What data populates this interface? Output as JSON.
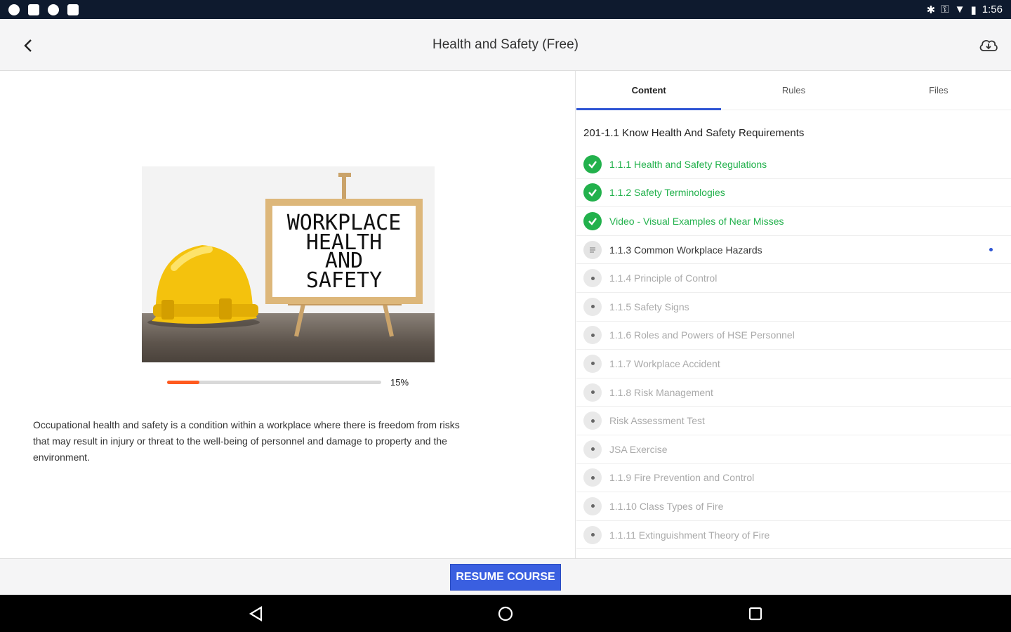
{
  "status_bar": {
    "time": "1:56"
  },
  "app_bar": {
    "title": "Health and Safety (Free)"
  },
  "course": {
    "image_text_lines": [
      "WORKPLACE",
      "HEALTH",
      "AND",
      "SAFETY"
    ],
    "progress_percent": 15,
    "progress_label": "15%",
    "description": "Occupational health and safety is a condition within a workplace where there is freedom from risks that may result in injury or threat to the well-being of personnel and damage to property and the environment."
  },
  "tabs": [
    {
      "label": "Content",
      "active": true
    },
    {
      "label": "Rules",
      "active": false
    },
    {
      "label": "Files",
      "active": false
    }
  ],
  "section": {
    "title": "201-1.1 Know Health And Safety Requirements"
  },
  "lessons": [
    {
      "label": "1.1.1 Health and Safety Regulations",
      "state": "completed"
    },
    {
      "label": "1.1.2 Safety Terminologies",
      "state": "completed"
    },
    {
      "label": "Video - Visual Examples of Near Misses",
      "state": "completed"
    },
    {
      "label": "1.1.3 Common Workplace Hazards",
      "state": "current"
    },
    {
      "label": "1.1.4 Principle of Control",
      "state": "locked"
    },
    {
      "label": "1.1.5 Safety Signs",
      "state": "locked"
    },
    {
      "label": "1.1.6 Roles and Powers of HSE Personnel",
      "state": "locked"
    },
    {
      "label": "1.1.7 Workplace Accident",
      "state": "locked"
    },
    {
      "label": "1.1.8 Risk Management",
      "state": "locked"
    },
    {
      "label": "Risk Assessment Test",
      "state": "locked"
    },
    {
      "label": "JSA Exercise",
      "state": "locked"
    },
    {
      "label": "1.1.9 Fire Prevention and Control",
      "state": "locked"
    },
    {
      "label": "1.1.10 Class Types of Fire",
      "state": "locked"
    },
    {
      "label": "1.1.11 Extinguishment Theory of Fire",
      "state": "locked"
    }
  ],
  "bottom": {
    "resume_label": "RESUME COURSE"
  },
  "colors": {
    "accent": "#2f55d4",
    "completed": "#22b14c",
    "progress": "#ff5a1f",
    "button": "#3a5fe0"
  },
  "icons": [
    "back-arrow-icon",
    "cloud-download-icon",
    "check-icon",
    "nav-back-icon",
    "nav-home-icon",
    "nav-recents-icon"
  ]
}
